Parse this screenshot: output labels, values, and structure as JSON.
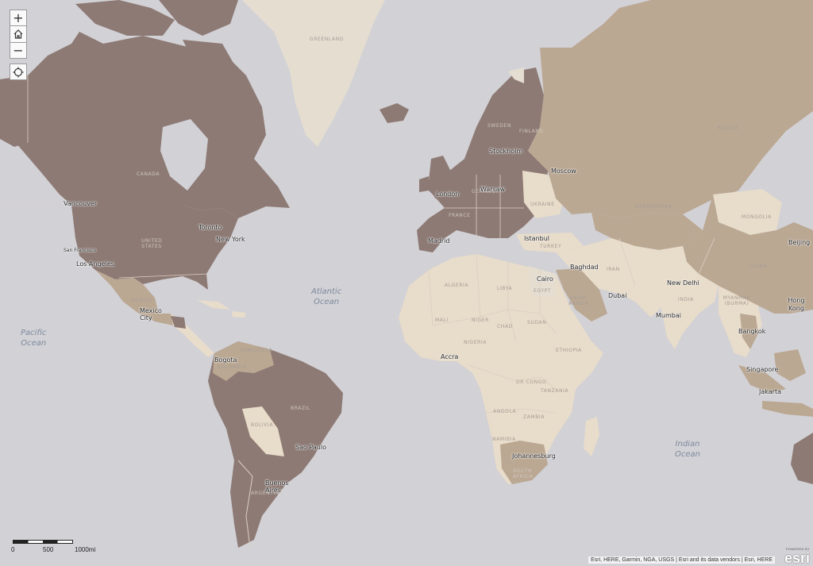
{
  "map": {
    "colors": {
      "ocean": "#d2d1d6",
      "dark": "#8d7a74",
      "medium": "#bba893",
      "light": "#e8dcca",
      "pale": "#e4ddd0",
      "border": "#d9cfc4"
    },
    "controls": {
      "zoom_in": "+",
      "home_icon": "home-icon",
      "zoom_out": "−",
      "locate_icon": "locate-icon"
    },
    "oceans": [
      {
        "name": "Pacific Ocean",
        "line1": "Pacific",
        "line2": "Ocean"
      },
      {
        "name": "Atlantic Ocean",
        "line1": "Atlantic",
        "line2": "Ocean"
      },
      {
        "name": "Indian Ocean",
        "line1": "Indian",
        "line2": "Ocean"
      }
    ],
    "cities": [
      "Vancouver",
      "Toronto",
      "New York",
      "San Francisco",
      "Los Angeles",
      "Mexico City",
      "Bogota",
      "Sao Paulo",
      "Buenos Aires",
      "London",
      "Stockholm",
      "Moscow",
      "Warsaw",
      "Madrid",
      "Istanbul",
      "Cairo",
      "Baghdad",
      "Dubai",
      "New Delhi",
      "Mumbai",
      "Beijing",
      "Hong Kong",
      "Bangkok",
      "Singapore",
      "Jakarta",
      "Accra",
      "Johannesburg"
    ],
    "countries": [
      "GREENLAND",
      "CANADA",
      "UNITED STATES",
      "MEXICO",
      "VENEZUELA",
      "COLOMBIA",
      "BRAZIL",
      "BOLIVIA",
      "ARGENTINA",
      "RUSSIA",
      "KAZAKHSTAN",
      "MONGOLIA",
      "CHINA",
      "INDIA",
      "IRAN",
      "TURKEY",
      "UKRAINE",
      "GERMANY",
      "FRANCE",
      "SWEDEN",
      "FINLAND",
      "ALGERIA",
      "LIBYA",
      "EGYPT",
      "SAUDI ARABIA",
      "MALI",
      "NIGER",
      "CHAD",
      "SUDAN",
      "NIGERIA",
      "ETHIOPIA",
      "DR CONGO",
      "TANZANIA",
      "ANGOLA",
      "ZAMBIA",
      "NAMIBIA",
      "SOUTH AFRICA",
      "MYANMAR (BURMA)"
    ],
    "scale": {
      "zero": "0",
      "mid": "500",
      "end": "1000mi"
    },
    "attribution": "Esri, HERE, Garmin, NGA, USGS | Esri and its data vendors | Esri, HERE",
    "logo": {
      "powered_by": "POWERED BY",
      "wordmark": "esri"
    }
  }
}
